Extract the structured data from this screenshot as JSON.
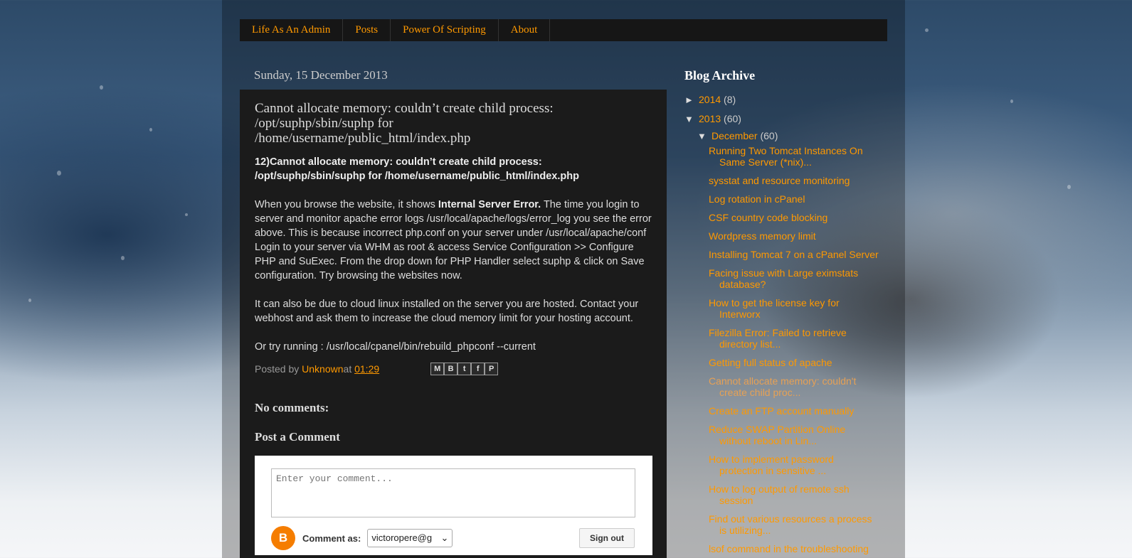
{
  "nav": {
    "tabs": [
      {
        "label": "Life As An Admin"
      },
      {
        "label": "Posts"
      },
      {
        "label": "Power Of Scripting"
      },
      {
        "label": "About"
      }
    ]
  },
  "date_header": "Sunday, 15 December 2013",
  "post": {
    "title": "Cannot allocate memory: couldn’t create child process: /opt/suphp/sbin/suphp for /home/username/public_html/index.php",
    "heading": "12)Cannot allocate memory: couldn’t create child process: /opt/suphp/sbin/suphp for /home/username/public_html/index.php",
    "p1_a": "When you browse the website, it shows ",
    "p1_b": "Internal Server Error.",
    "p1_c": " The time you login to server and monitor apache error logs /usr/local/apache/logs/error_log you see the error above. This is because incorrect php.conf on your server under /usr/local/apache/conf",
    "p2": "Login to your server via WHM as root & access Service Configuration >> Configure PHP and SuExec. From the drop down for PHP Handler select suphp & click on Save configuration. Try browsing the websites now.",
    "p3": "It can also be due to cloud linux installed on the server you are hosted. Contact your webhost and ask them to increase the cloud memory limit for your hosting account.",
    "p4": "Or try running : /usr/local/cpanel/bin/rebuild_phpconf  --current",
    "footer": {
      "posted_by": "Posted by ",
      "author": "Unknown",
      "at": " at ",
      "time": "01:29"
    },
    "share_icons": [
      "email-icon",
      "blogthis-icon",
      "twitter-icon",
      "facebook-icon",
      "pinterest-icon"
    ]
  },
  "comments": {
    "heading": "No comments:",
    "post_heading": "Post a Comment",
    "placeholder": "Enter your comment...",
    "comment_as": "Comment as:",
    "account": "victoropere@g",
    "sign_out": "Sign out"
  },
  "sidebar": {
    "title": "Blog Archive",
    "years": [
      {
        "toggle": "►",
        "year": "2014",
        "count": "(8)"
      },
      {
        "toggle": "▼",
        "year": "2013",
        "count": "(60)"
      }
    ],
    "month": {
      "toggle": "▼",
      "name": "December",
      "count": "(60)"
    },
    "posts": [
      "Running Two Tomcat Instances On Same Server (*nix)...",
      "sysstat and resource monitoring",
      "Log rotation in cPanel",
      "CSF country code blocking",
      "Wordpress memory limit",
      "Installing Tomcat 7 on a cPanel Server",
      "Facing issue with Large eximstats database?",
      "How to get the license key for Interworx",
      "Filezilla Error: Failed to retrieve directory list...",
      "Getting full status of apache",
      "Cannot allocate memory: couldn't create child proc...",
      "Create an FTP account manually",
      "Reduce SWAP Partition Online without reboot in Lin...",
      "How to implement password protection in sensitive ...",
      "How to log output of remote ssh session",
      "Find out various resources a process is utilizing...",
      "lsof command in the troubleshooting purpose"
    ]
  }
}
